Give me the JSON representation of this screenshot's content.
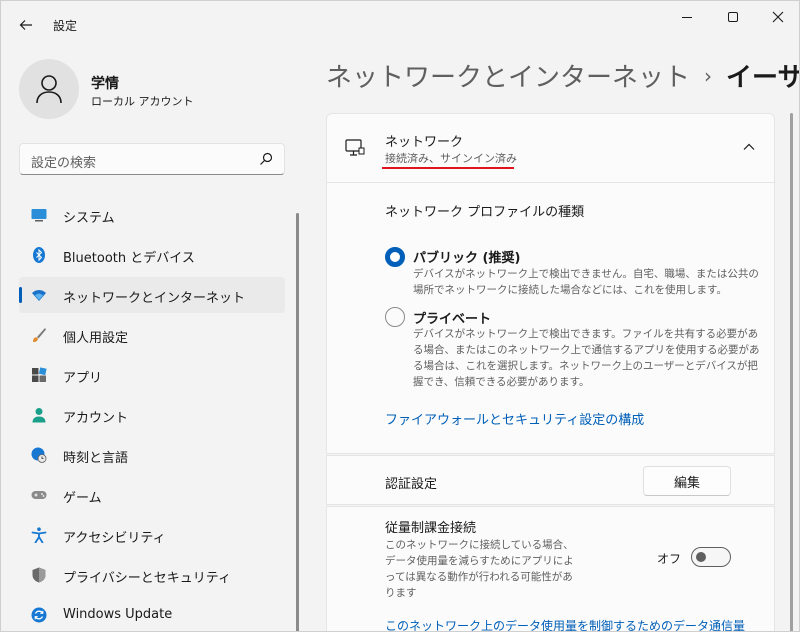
{
  "window": {
    "app_title": "設定"
  },
  "user": {
    "name": "学情",
    "account_type": "ローカル アカウント"
  },
  "search": {
    "placeholder": "設定の検索"
  },
  "sidebar": {
    "items": [
      {
        "label": "システム",
        "icon": "monitor-icon"
      },
      {
        "label": "Bluetooth とデバイス",
        "icon": "bluetooth-icon"
      },
      {
        "label": "ネットワークとインターネット",
        "icon": "wifi-icon",
        "active": true
      },
      {
        "label": "個人用設定",
        "icon": "brush-icon"
      },
      {
        "label": "アプリ",
        "icon": "apps-icon"
      },
      {
        "label": "アカウント",
        "icon": "person-icon"
      },
      {
        "label": "時刻と言語",
        "icon": "globe-clock-icon"
      },
      {
        "label": "ゲーム",
        "icon": "gamepad-icon"
      },
      {
        "label": "アクセシビリティ",
        "icon": "accessibility-icon"
      },
      {
        "label": "プライバシーとセキュリティ",
        "icon": "shield-icon"
      },
      {
        "label": "Windows Update",
        "icon": "update-icon"
      }
    ]
  },
  "breadcrumb": {
    "parent": "ネットワークとインターネット",
    "separator": "›",
    "current": "イーサネット"
  },
  "network": {
    "title": "ネットワーク",
    "status": "接続済み、サインイン済み"
  },
  "profile_type": {
    "label": "ネットワーク プロファイルの種類",
    "public": {
      "title": "パブリック (推奨)",
      "description": "デバイスがネットワーク上で検出できません。自宅、職場、または公共の場所でネットワークに接続した場合などには、これを使用します。",
      "selected": true
    },
    "private": {
      "title": "プライベート",
      "description": "デバイスがネットワーク上で検出できます。ファイルを共有する必要がある場合、またはこのネットワーク上で通信するアプリを使用する必要がある場合は、これを選択します。ネットワーク上のユーザーとデバイスが把握でき、信頼できる必要があります。",
      "selected": false
    }
  },
  "firewall_link": "ファイアウォールとセキュリティ設定の構成",
  "auth": {
    "label": "認証設定",
    "edit_label": "編集"
  },
  "metered": {
    "title": "従量制課金接続",
    "description": "このネットワークに接続している場合、データ使用量を減らすためにアプリによっては異なる動作が行われる可能性があります",
    "toggle_label": "オフ",
    "enabled": false
  },
  "data_limit_link": "このネットワーク上のデータ使用量を制御するためのデータ通信量",
  "colors": {
    "accent": "#005fb8",
    "status_underline": "#e0141e"
  }
}
